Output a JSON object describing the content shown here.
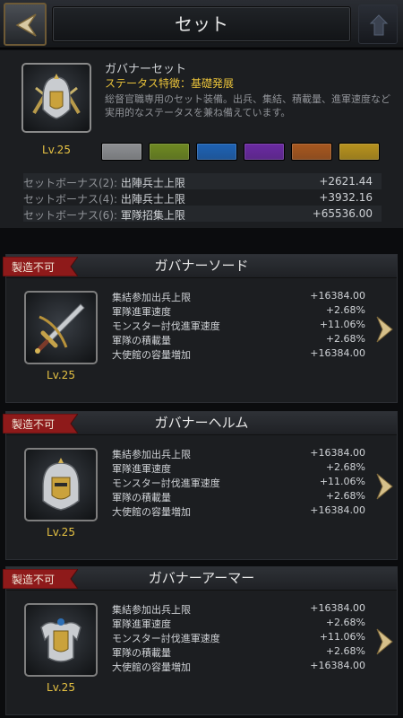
{
  "header": {
    "title": "セット"
  },
  "set": {
    "name": "ガバナーセット",
    "trait": "ステータス特徴：基礎発展",
    "description": "総督官職専用のセット装備。出兵、集結、積載量、進軍速度など実用的なステータスを兼ね備えています。",
    "level": "Lv.25",
    "swatch_colors": [
      "#8e9093",
      "#6f8a22",
      "#1e63b5",
      "#6b2aa3",
      "#a8581f",
      "#b8931e"
    ],
    "bonuses": [
      {
        "label": "セットボーナス(2): ",
        "stat": "出陣兵士上限",
        "value": "+2621.44"
      },
      {
        "label": "セットボーナス(4): ",
        "stat": "出陣兵士上限",
        "value": "+3932.16"
      },
      {
        "label": "セットボーナス(6): ",
        "stat": "軍隊招集上限",
        "value": "+65536.00"
      }
    ]
  },
  "items": [
    {
      "ribbon": "製造不可",
      "name": "ガバナーソード",
      "icon": "sword-icon",
      "level": "Lv.25",
      "stats": [
        {
          "label": "集結参加出兵上限",
          "value": "+16384.00"
        },
        {
          "label": "軍隊進軍速度",
          "value": "+2.68%"
        },
        {
          "label": "モンスター討伐進軍速度",
          "value": "+11.06%"
        },
        {
          "label": "軍隊の積載量",
          "value": "+2.68%"
        },
        {
          "label": "大使館の容量増加",
          "value": "+16384.00"
        }
      ]
    },
    {
      "ribbon": "製造不可",
      "name": "ガバナーヘルム",
      "icon": "helmet-icon",
      "level": "Lv.25",
      "stats": [
        {
          "label": "集結参加出兵上限",
          "value": "+16384.00"
        },
        {
          "label": "軍隊進軍速度",
          "value": "+2.68%"
        },
        {
          "label": "モンスター討伐進軍速度",
          "value": "+11.06%"
        },
        {
          "label": "軍隊の積載量",
          "value": "+2.68%"
        },
        {
          "label": "大使館の容量増加",
          "value": "+16384.00"
        }
      ]
    },
    {
      "ribbon": "製造不可",
      "name": "ガバナーアーマー",
      "icon": "armor-icon",
      "level": "Lv.25",
      "stats": [
        {
          "label": "集結参加出兵上限",
          "value": "+16384.00"
        },
        {
          "label": "軍隊進軍速度",
          "value": "+2.68%"
        },
        {
          "label": "モンスター討伐進軍速度",
          "value": "+11.06%"
        },
        {
          "label": "軍隊の積載量",
          "value": "+2.68%"
        },
        {
          "label": "大使館の容量増加",
          "value": "+16384.00"
        }
      ]
    }
  ]
}
